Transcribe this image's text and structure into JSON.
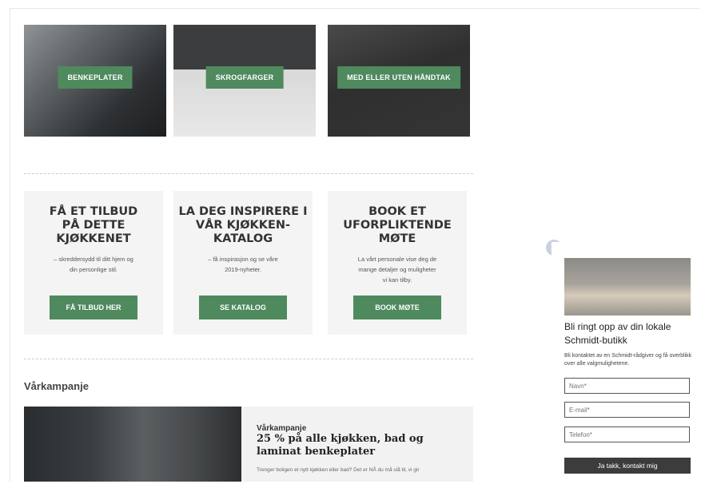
{
  "tiles": [
    {
      "label": "BENKEPLATER"
    },
    {
      "label": "SKROGFARGER"
    },
    {
      "label": "MED ELLER UTEN HÅNDTAK"
    }
  ],
  "cards": [
    {
      "heading": "FÅ ET TILBUD\nPÅ DETTE\nKJØKKENET",
      "text": "– skreddersydd til ditt hjem og\ndin personlige stil.",
      "button": "FÅ TILBUD HER"
    },
    {
      "heading": "LA DEG INSPIRERE I\nVÅR KJØKKEN-\nKATALOG",
      "text": "– få inspirasjon og se våre\n2019-nyheter.",
      "button": "SE KATALOG"
    },
    {
      "heading": "BOOK ET\nUFORPLIKTENDE\nMØTE",
      "text": "La vårt personale vise deg de\nmange detaljer og muligheter\nvi kan tilby.",
      "button": "BOOK MØTE"
    }
  ],
  "campaign": {
    "section_title": "Vårkampanje",
    "kicker": "Vårkampanje",
    "title": "25 % på alle kjøkken, bad og laminat benkeplater",
    "text": "Trenger boligen et nytt kjøkken eller bad? Det er NÅ du må slå til, vi gir"
  },
  "widget": {
    "close_symbol": "✕",
    "title": "Bli ringt opp av din lokale Schmidt-butikk",
    "description": "Bli kontaktet av en Schmidt-rådgiver og få overblikk over alle valgmulighetene.",
    "name_placeholder": "Navn*",
    "email_placeholder": "E-mail*",
    "phone_placeholder": "Telefon*",
    "submit": "Ja takk, kontakt mig"
  },
  "colors": {
    "accent_green": "#4e8a5d",
    "submit_dark": "#3c3c3c"
  }
}
